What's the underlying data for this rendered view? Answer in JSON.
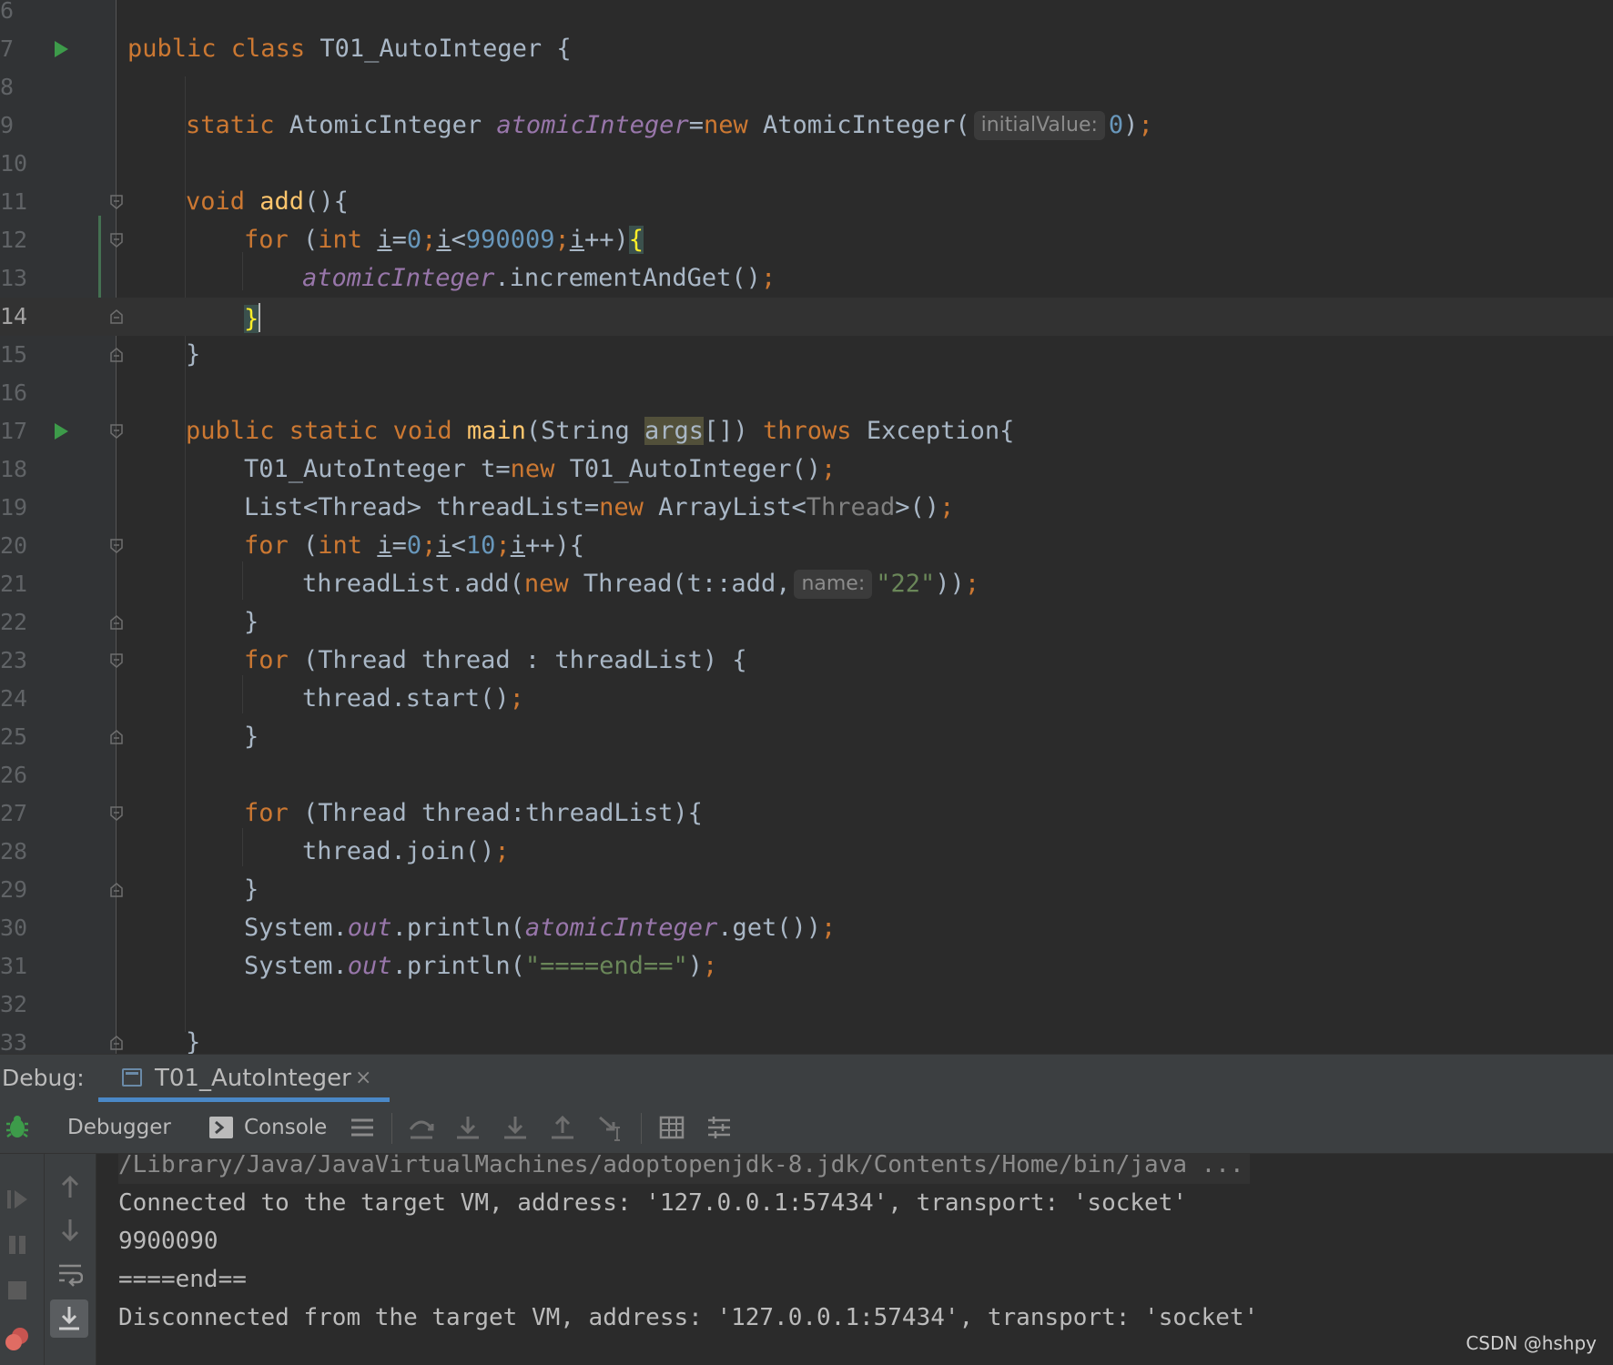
{
  "editor": {
    "line_numbers": [
      "6",
      "7",
      "8",
      "9",
      "10",
      "11",
      "12",
      "13",
      "14",
      "15",
      "16",
      "17",
      "18",
      "19",
      "20",
      "21",
      "22",
      "23",
      "24",
      "25",
      "26",
      "27",
      "28",
      "29",
      "30",
      "31",
      "32",
      "33"
    ],
    "current_line": "14",
    "tokens": {
      "l7_public": "public ",
      "l7_class": "class ",
      "l7_name": "T01_AutoInteger {",
      "l9_static": "static ",
      "l9_type": "AtomicInteger ",
      "l9_field": "atomicInteger",
      "l9_eq": "=",
      "l9_new": "new ",
      "l9_ctor": "AtomicInteger(",
      "l9_hint": "initialValue:",
      "l9_zero": "0",
      "l9_close": ")",
      "l9_semi": ";",
      "l11_void": "void ",
      "l11_add": "add",
      "l11_rest": "(){",
      "l12_for": "for ",
      "l12_p1": "(",
      "l12_int": "int ",
      "l12_i1": "i",
      "l12_eq": "=",
      "l12_zero": "0",
      "l12_semi1": ";",
      "l12_i2": "i",
      "l12_lt": "<",
      "l12_num": "990009",
      "l12_semi2": ";",
      "l12_i3": "i",
      "l12_inc": "++)",
      "l12_brace": "{",
      "l13_field": "atomicInteger",
      "l13_call": ".incrementAndGet()",
      "l13_semi": ";",
      "l14_brace": "}",
      "l15_brace": "}",
      "l17_public": "public ",
      "l17_static": "static ",
      "l17_void": "void ",
      "l17_main": "main",
      "l17_p": "(String ",
      "l17_args": "args",
      "l17_arr": "[]) ",
      "l17_throws": "throws ",
      "l17_exc": "Exception{",
      "l18_a": "T01_AutoInteger t=",
      "l18_new": "new ",
      "l18_b": "T01_AutoInteger()",
      "l18_semi": ";",
      "l19_a": "List<Thread> threadList=",
      "l19_new": "new ",
      "l19_b": "ArrayList<",
      "l19_gen": "Thread",
      "l19_c": ">()",
      "l19_semi": ";",
      "l20_for": "for ",
      "l20_p1": "(",
      "l20_int": "int ",
      "l20_i1": "i",
      "l20_eq": "=",
      "l20_zero": "0",
      "l20_semi1": ";",
      "l20_i2": "i",
      "l20_lt": "<",
      "l20_num": "10",
      "l20_semi2": ";",
      "l20_i3": "i",
      "l20_inc": "++){",
      "l21_a": "threadList.add(",
      "l21_new": "new ",
      "l21_b": "Thread(t::add,",
      "l21_hint": "name:",
      "l21_str": "\"22\"",
      "l21_c": "))",
      "l21_semi": ";",
      "l22_brace": "}",
      "l23_for": "for ",
      "l23_rest": "(Thread thread : threadList) {",
      "l24_a": "thread.start()",
      "l24_semi": ";",
      "l25_brace": "}",
      "l27_for": "for ",
      "l27_rest": "(Thread thread:threadList){",
      "l28_a": "thread.join()",
      "l28_semi": ";",
      "l29_brace": "}",
      "l30_a": "System.",
      "l30_out": "out",
      "l30_b": ".println(",
      "l30_field": "atomicInteger",
      "l30_c": ".get())",
      "l30_semi": ";",
      "l31_a": "System.",
      "l31_out": "out",
      "l31_b": ".println(",
      "l31_str": "\"====end==\"",
      "l31_c": ")",
      "l31_semi": ";",
      "l33_brace": "}"
    }
  },
  "debug": {
    "label": "Debug:",
    "tab_label": "T01_AutoInteger",
    "tab_close": "×",
    "tabs": {
      "debugger": "Debugger",
      "console": "Console"
    }
  },
  "console": {
    "lines": [
      "/Library/Java/JavaVirtualMachines/adoptopenjdk-8.jdk/Contents/Home/bin/java ...",
      "Connected to the target VM, address: '127.0.0.1:57434', transport: 'socket'",
      "9900090",
      "====end==",
      "Disconnected from the target VM, address: '127.0.0.1:57434', transport: 'socket'"
    ]
  },
  "watermark": "CSDN @hshpy",
  "colors": {
    "background": "#2b2b2b",
    "keyword": "#cc7832",
    "method": "#ffc66d",
    "number": "#6897bb",
    "string": "#6a8759",
    "field": "#9876aa"
  }
}
